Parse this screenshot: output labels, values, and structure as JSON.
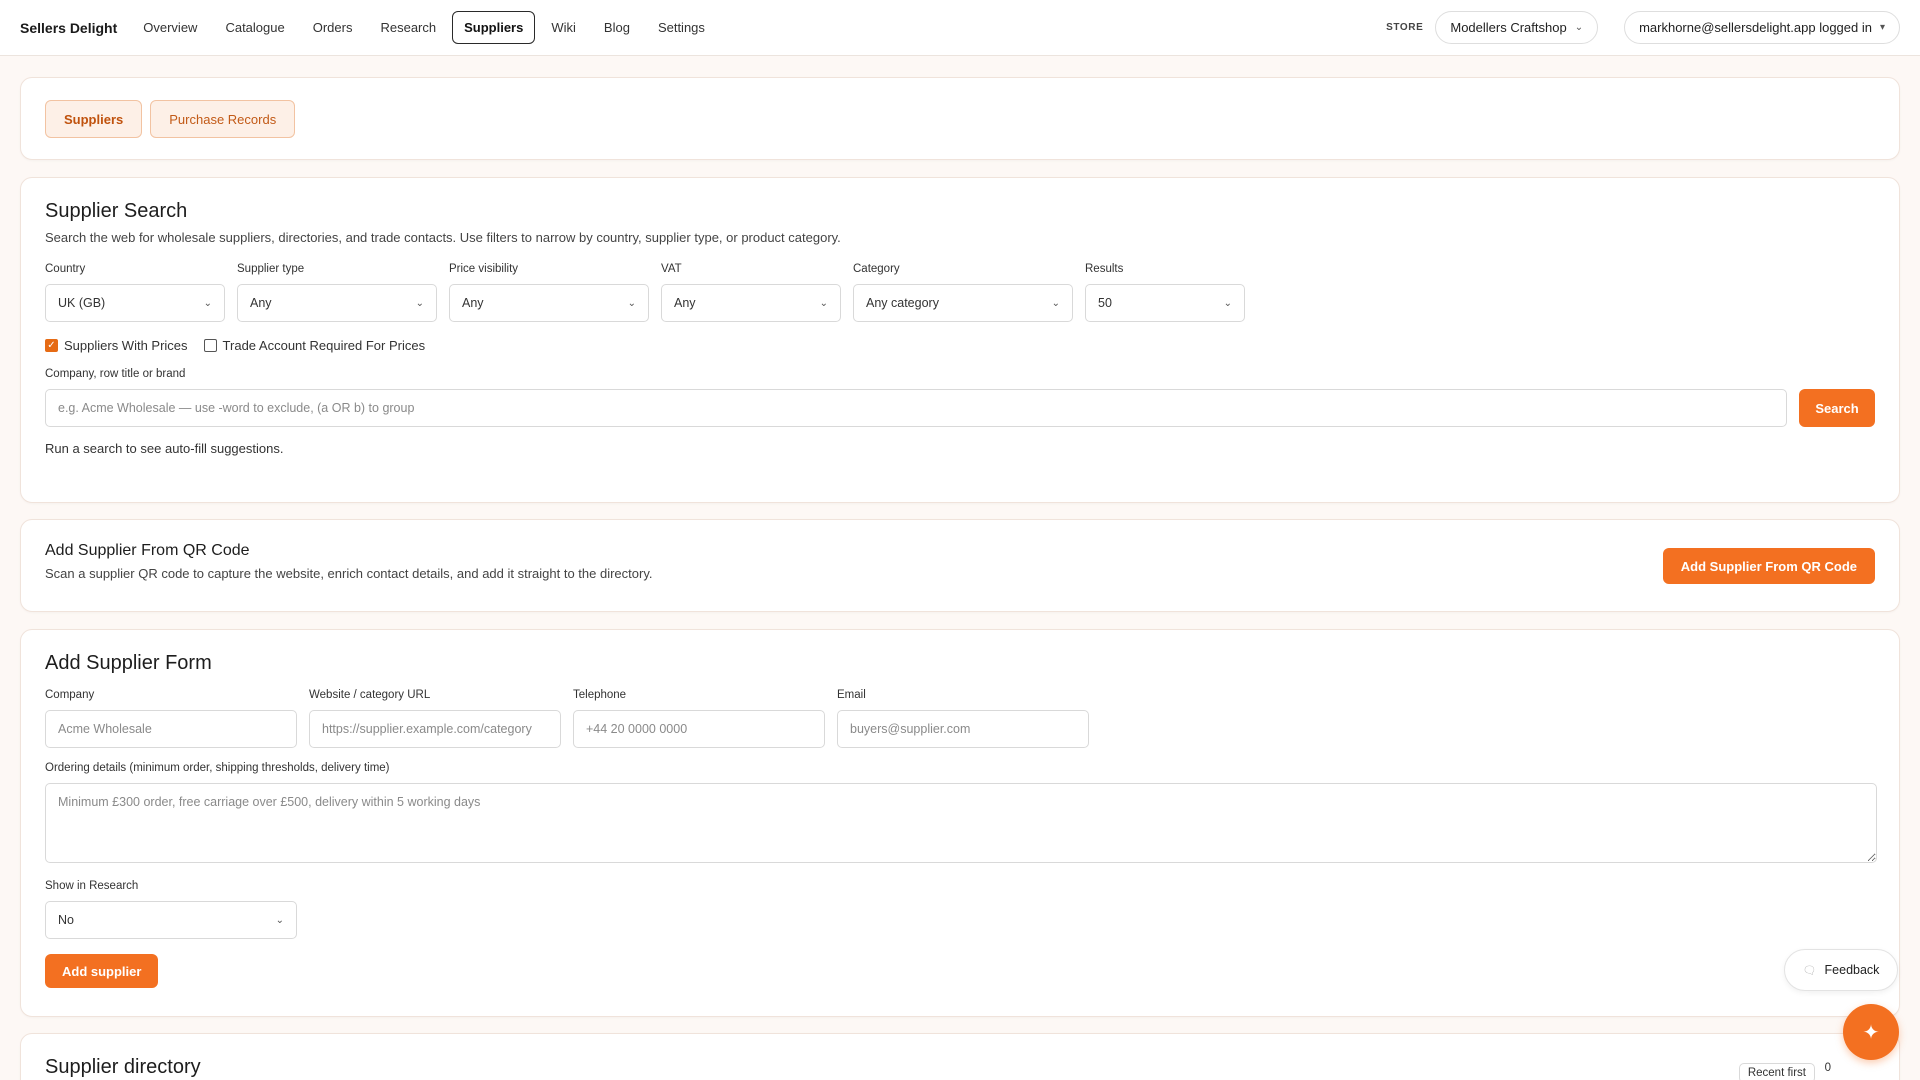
{
  "header": {
    "brand": "Sellers Delight",
    "nav": [
      {
        "label": "Overview",
        "active": false
      },
      {
        "label": "Catalogue",
        "active": false
      },
      {
        "label": "Orders",
        "active": false
      },
      {
        "label": "Research",
        "active": false
      },
      {
        "label": "Suppliers",
        "active": true
      },
      {
        "label": "Wiki",
        "active": false
      },
      {
        "label": "Blog",
        "active": false
      },
      {
        "label": "Settings",
        "active": false
      }
    ],
    "store_label": "STORE",
    "store_value": "Modellers Craftshop",
    "user": "markhorne@sellersdelight.app logged in"
  },
  "subtabs": [
    {
      "label": "Suppliers",
      "active": true
    },
    {
      "label": "Purchase Records",
      "active": false
    }
  ],
  "search": {
    "title": "Supplier Search",
    "description": "Search the web for wholesale suppliers, directories, and trade contacts. Use filters to narrow by country, supplier type, or product category.",
    "filters": [
      {
        "label": "Country",
        "value": "UK (GB)"
      },
      {
        "label": "Supplier type",
        "value": "Any"
      },
      {
        "label": "Price visibility",
        "value": "Any"
      },
      {
        "label": "VAT",
        "value": "Any"
      },
      {
        "label": "Category",
        "value": "Any category"
      },
      {
        "label": "Results",
        "value": "50"
      }
    ],
    "checkboxes": [
      {
        "label": "Suppliers With Prices",
        "checked": true
      },
      {
        "label": "Trade Account Required For Prices",
        "checked": false
      }
    ],
    "query_label": "Company, row title or brand",
    "query_placeholder": "e.g. Acme Wholesale — use -word to exclude, (a OR b) to group",
    "button": "Search",
    "hint": "Run a search to see auto-fill suggestions."
  },
  "qr": {
    "title": "Add Supplier From QR Code",
    "description": "Scan a supplier QR code to capture the website, enrich contact details, and add it straight to the directory.",
    "button": "Add Supplier From QR Code"
  },
  "form": {
    "title": "Add Supplier Form",
    "fields": [
      {
        "label": "Company",
        "placeholder": "Acme Wholesale"
      },
      {
        "label": "Website / category URL",
        "placeholder": "https://supplier.example.com/category"
      },
      {
        "label": "Telephone",
        "placeholder": "+44 20 0000 0000"
      },
      {
        "label": "Email",
        "placeholder": "buyers@supplier.com"
      }
    ],
    "ordering_label": "Ordering details (minimum order, shipping thresholds, delivery time)",
    "ordering_placeholder": "Minimum £300 order, free carriage over £500, delivery within 5 working days",
    "show_label": "Show in Research",
    "show_value": "No",
    "button": "Add supplier"
  },
  "directory": {
    "title": "Supplier directory",
    "sort": "Recent first",
    "count": "0"
  },
  "feedback": "Feedback",
  "colors": {
    "accent": "#f37021",
    "subtab_bg": "#fdf0e7"
  }
}
